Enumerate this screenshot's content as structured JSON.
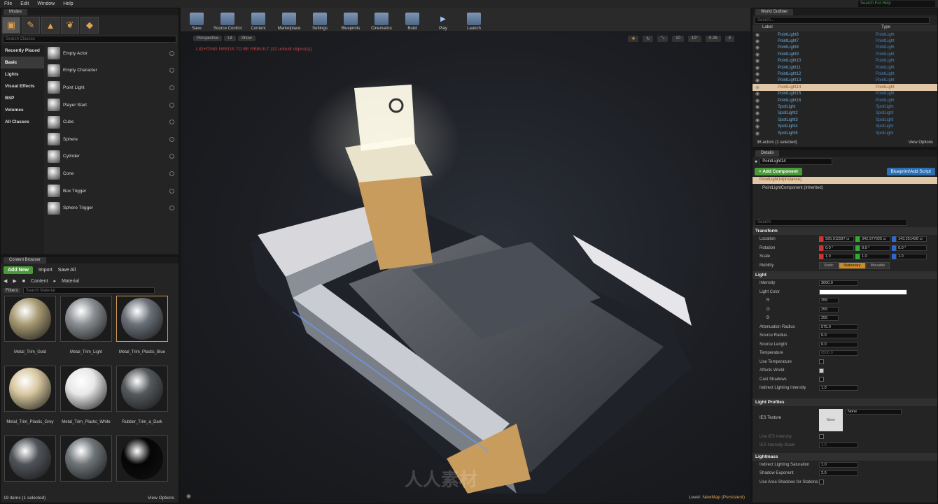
{
  "menu": [
    "File",
    "Edit",
    "Window",
    "Help"
  ],
  "search_help": "Search For Help",
  "modes": {
    "tab": "Modes",
    "search_placeholder": "Search Classes",
    "categories": [
      "Recently Placed",
      "Basic",
      "Lights",
      "Visual Effects",
      "BSP",
      "Volumes",
      "All Classes"
    ],
    "selected_category": "Basic",
    "items": [
      "Empty Actor",
      "Empty Character",
      "Point Light",
      "Player Start",
      "Cube",
      "Sphere",
      "Cylinder",
      "Cone",
      "Box Trigger",
      "Sphere Trigger"
    ]
  },
  "toolbar": [
    {
      "label": "Save",
      "icon": "save-icon"
    },
    {
      "label": "Source Control",
      "icon": "source-control-icon"
    },
    {
      "label": "Content",
      "icon": "content-icon"
    },
    {
      "label": "Marketplace",
      "icon": "marketplace-icon"
    },
    {
      "label": "Settings",
      "icon": "settings-icon"
    },
    {
      "label": "Blueprints",
      "icon": "blueprints-icon"
    },
    {
      "label": "Cinematics",
      "icon": "cinematics-icon"
    },
    {
      "label": "Build",
      "icon": "build-icon"
    },
    {
      "label": "Play",
      "icon": "play-icon"
    },
    {
      "label": "Launch",
      "icon": "launch-icon"
    }
  ],
  "viewport": {
    "buttons": [
      "Perspective",
      "Lit",
      "Show"
    ],
    "warning": "LIGHTING NEEDS TO BE REBUILT (32 unbuilt object(s))",
    "snap_values": [
      "10",
      "10°",
      "0.25",
      "4"
    ],
    "level_label": "Level:",
    "level_name": "NewMap (Persistent)"
  },
  "content_browser": {
    "tab": "Content Browser",
    "add_new": "Add New",
    "import": "Import",
    "save_all": "Save All",
    "path": [
      "Content",
      "Material"
    ],
    "filters": "Filters",
    "search_placeholder": "Search Material",
    "materials": [
      {
        "name": "Metal_Trim_Gold",
        "color": "#a89a72"
      },
      {
        "name": "Metal_Trim_Light",
        "color": "#8a8e92"
      },
      {
        "name": "Metal_Trim_Plastic_Blue",
        "color": "#6a7078"
      },
      {
        "name": "Metal_Trim_Plastic_Grey",
        "color": "#d8c8a0"
      },
      {
        "name": "Metal_Trim_Plastic_White",
        "color": "#e8e8e8"
      },
      {
        "name": "Rubber_Trim_a_Dark",
        "color": "#55595c"
      },
      {
        "name": "",
        "color": "#50545a"
      },
      {
        "name": "",
        "color": "#6e7478"
      },
      {
        "name": "",
        "color": "#050505"
      }
    ],
    "selected_index": 2,
    "status": "19 items (1 selected)",
    "view_options": "View Options"
  },
  "outliner": {
    "tab": "World Outliner",
    "search_placeholder": "Search...",
    "col_label": "Label",
    "col_type": "Type",
    "rows": [
      {
        "label": "PointLight6",
        "type": "PointLight"
      },
      {
        "label": "PointLight7",
        "type": "PointLight"
      },
      {
        "label": "PointLight8",
        "type": "PointLight"
      },
      {
        "label": "PointLight9",
        "type": "PointLight"
      },
      {
        "label": "PointLight10",
        "type": "PointLight"
      },
      {
        "label": "PointLight11",
        "type": "PointLight"
      },
      {
        "label": "PointLight12",
        "type": "PointLight"
      },
      {
        "label": "PointLight13",
        "type": "PointLight"
      },
      {
        "label": "PointLight14",
        "type": "PointLight"
      },
      {
        "label": "PointLight15",
        "type": "PointLight"
      },
      {
        "label": "PointLight16",
        "type": "PointLight"
      },
      {
        "label": "SpotLight",
        "type": "SpotLight"
      },
      {
        "label": "SpotLight2",
        "type": "SpotLight"
      },
      {
        "label": "SpotLight3",
        "type": "SpotLight"
      },
      {
        "label": "SpotLight4",
        "type": "SpotLight"
      },
      {
        "label": "SpotLight5",
        "type": "SpotLight"
      }
    ],
    "selected_index": 8,
    "status": "36 actors (1 selected)",
    "view_options": "View Options"
  },
  "details": {
    "tab": "Details",
    "name": "PointLight14",
    "add_component": "+ Add Component",
    "blueprint": "Blueprint/Add Script",
    "instance": "PointLight14(Instance)",
    "component": "PointLightComponent (Inherited)",
    "search_placeholder": "Search",
    "transform": {
      "title": "Transform",
      "location_label": "Location",
      "location": [
        "925.011597 cr",
        "342.977025 cr",
        "143.251428 cr"
      ],
      "rotation_label": "Rotation",
      "rotation": [
        "0.0 °",
        "0.0 °",
        "0.0 °"
      ],
      "scale_label": "Scale",
      "scale": [
        "1.0",
        "1.0",
        "1.0"
      ],
      "mobility_label": "Mobility",
      "mobility": [
        "Static",
        "Stationary",
        "Movable"
      ],
      "mobility_selected": 1
    },
    "light": {
      "title": "Light",
      "props": [
        {
          "label": "Intensity",
          "value": "3000.0"
        },
        {
          "label": "Light Color",
          "value": ""
        },
        {
          "label": "R",
          "value": "255"
        },
        {
          "label": "G",
          "value": "255"
        },
        {
          "label": "B",
          "value": "255"
        },
        {
          "label": "Attenuation Radius",
          "value": "575.0"
        },
        {
          "label": "Source Radius",
          "value": "0.0"
        },
        {
          "label": "Source Length",
          "value": "0.0"
        },
        {
          "label": "Temperature",
          "value": "6500.0"
        }
      ],
      "checks": [
        {
          "label": "Use Temperature",
          "checked": false
        },
        {
          "label": "Affects World",
          "checked": true
        },
        {
          "label": "Cast Shadows",
          "checked": false
        }
      ],
      "indirect_label": "Indirect Lighting Intensity",
      "indirect_value": "1.0"
    },
    "light_profiles": {
      "title": "Light Profiles",
      "ies_label": "IES Texture",
      "ies_thumb": "None",
      "ies_value": "None",
      "ies_intensity_label": "Use IES Intensity",
      "ies_scale_label": "IES Intensity Scale",
      "ies_scale_value": "1.0"
    },
    "lightmass": {
      "title": "Lightmass",
      "props": [
        {
          "label": "Indirect Lighting Saturation",
          "value": "1.0"
        },
        {
          "label": "Shadow Exponent",
          "value": "2.0"
        }
      ],
      "area_label": "Use Area Shadows for Stationa"
    }
  },
  "watermark": "人人素材"
}
